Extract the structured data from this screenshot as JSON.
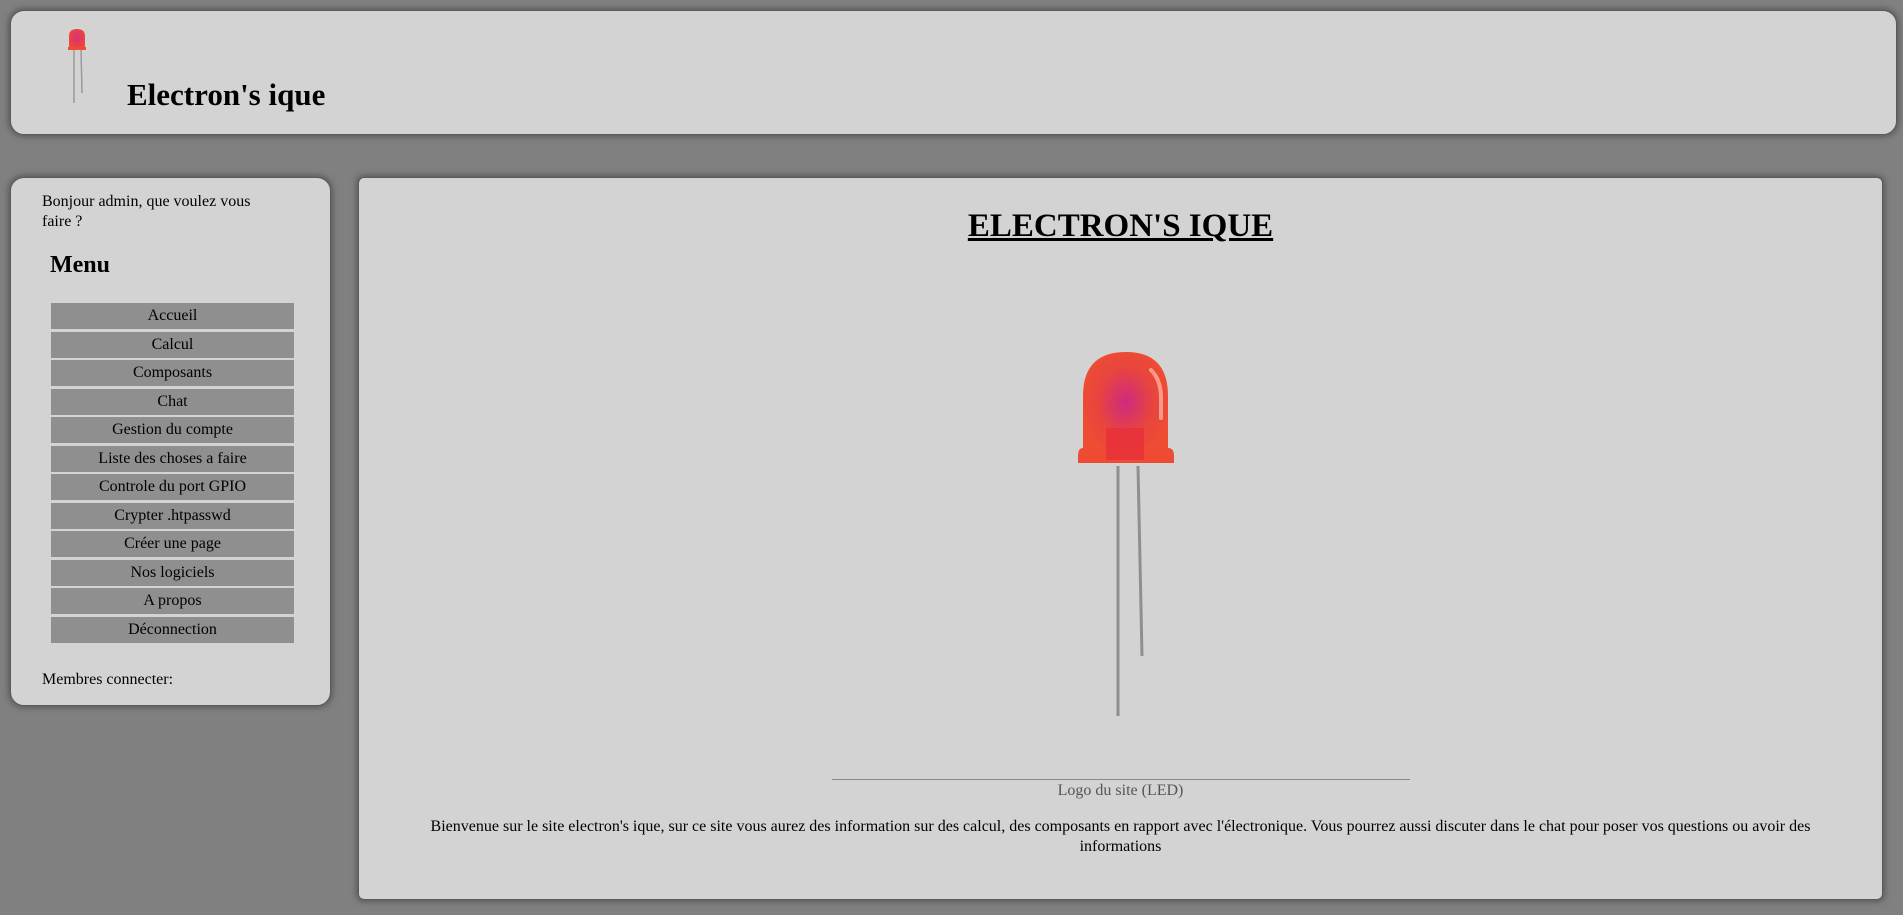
{
  "header": {
    "site_title": "Electron's ique",
    "logo_icon": "led-icon"
  },
  "sidebar": {
    "greeting": "Bonjour admin, que voulez vous faire ?",
    "menu_title": "Menu",
    "items": [
      {
        "label": "Accueil"
      },
      {
        "label": "Calcul"
      },
      {
        "label": "Composants"
      },
      {
        "label": "Chat"
      },
      {
        "label": "Gestion du compte"
      },
      {
        "label": "Liste des choses a faire"
      },
      {
        "label": "Controle du port GPIO"
      },
      {
        "label": "Crypter .htpasswd"
      },
      {
        "label": "Créer une page"
      },
      {
        "label": "Nos logiciels"
      },
      {
        "label": "A propos"
      },
      {
        "label": "Déconnection"
      }
    ],
    "members_label": "Membres connecter:"
  },
  "main": {
    "title": "ELECTRON'S IQUE",
    "figure_caption": "Logo du site (LED)",
    "welcome_text": "Bienvenue sur le site electron's ique, sur ce site vous aurez des information sur des calcul, des composants en rapport avec l'électronique. Vous pourrez aussi discuter dans le chat pour poser vos questions ou avoir des informations"
  },
  "colors": {
    "page_background": "#808080",
    "panel_background": "#d3d3d3",
    "menu_item_background": "#8f8f8f",
    "led_red": "#ee4a34"
  }
}
